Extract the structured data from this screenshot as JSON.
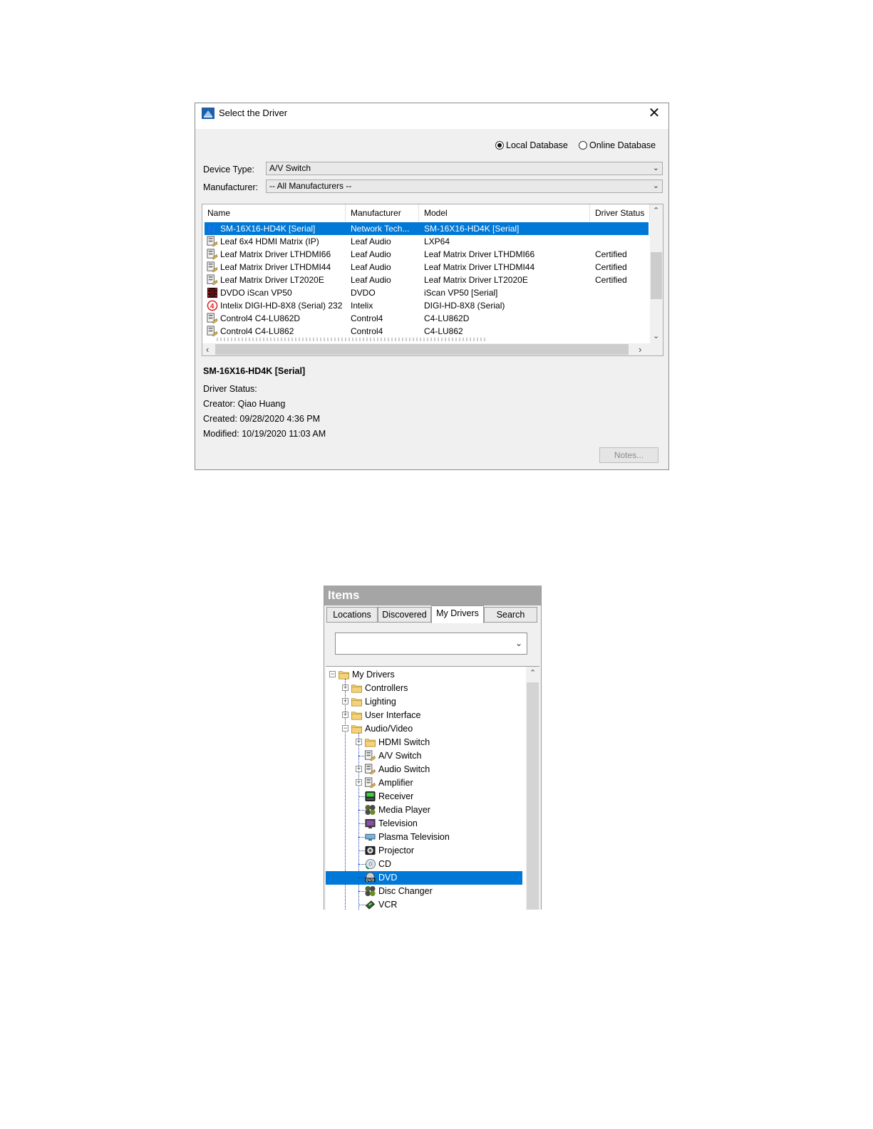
{
  "dialog": {
    "title": "Select the Driver",
    "close_glyph": "✕",
    "local_db_label": "Local Database",
    "online_db_label": "Online Database",
    "device_type_label": "Device Type:",
    "device_type_value": "A/V Switch",
    "manufacturer_label": "Manufacturer:",
    "manufacturer_value": "-- All Manufacturers --",
    "columns": [
      "Name",
      "Manufacturer",
      "Model",
      "Driver Status"
    ],
    "rows": [
      {
        "name": "SM-16X16-HD4K [Serial]",
        "manufacturer": "Network Tech...",
        "model": "SM-16X16-HD4K [Serial]",
        "status": "",
        "icon": "network-tech-icon",
        "selected": true
      },
      {
        "name": "Leaf 6x4 HDMI Matrix (IP)",
        "manufacturer": "Leaf Audio",
        "model": "LXP64",
        "status": "",
        "icon": "switch-driver-icon"
      },
      {
        "name": "Leaf Matrix Driver LTHDMI66",
        "manufacturer": "Leaf Audio",
        "model": "Leaf Matrix Driver LTHDMI66",
        "status": "Certified",
        "icon": "switch-driver-icon"
      },
      {
        "name": "Leaf Matrix Driver LTHDMI44",
        "manufacturer": "Leaf Audio",
        "model": "Leaf Matrix Driver LTHDMI44",
        "status": "Certified",
        "icon": "switch-driver-icon"
      },
      {
        "name": "Leaf Matrix Driver LT2020E",
        "manufacturer": "Leaf Audio",
        "model": "Leaf Matrix Driver LT2020E",
        "status": "Certified",
        "icon": "switch-driver-icon"
      },
      {
        "name": "DVDO iScan VP50",
        "manufacturer": "DVDO",
        "model": "iScan VP50 [Serial]",
        "status": "",
        "icon": "film-icon"
      },
      {
        "name": "Intelix DIGI-HD-8X8 (Serial) 232",
        "manufacturer": "Intelix",
        "model": "DIGI-HD-8X8 (Serial)",
        "status": "",
        "icon": "intelix-logo-icon"
      },
      {
        "name": "Control4 C4-LU862D",
        "manufacturer": "Control4",
        "model": "C4-LU862D",
        "status": "",
        "icon": "switch-driver-icon"
      },
      {
        "name": "Control4 C4-LU862",
        "manufacturer": "Control4",
        "model": "C4-LU862",
        "status": "",
        "icon": "switch-driver-icon"
      }
    ],
    "details": {
      "name": "SM-16X16-HD4K [Serial]",
      "status": "Driver Status:",
      "creator": "Creator: Qiao Huang",
      "created": "Created: 09/28/2020 4:36 PM",
      "modified": "Modified: 10/19/2020 11:03 AM"
    },
    "notes_label": "Notes..."
  },
  "items_panel": {
    "title": "Items",
    "tabs": [
      "Locations",
      "Discovered",
      "My Drivers",
      "Search"
    ],
    "active_tab": "My Drivers",
    "combo_value": "",
    "tree": [
      {
        "label": "My Drivers",
        "level": 0,
        "expander": "minus",
        "icon": "folder-icon"
      },
      {
        "label": "Controllers",
        "level": 1,
        "expander": "plus",
        "icon": "folder-icon"
      },
      {
        "label": "Lighting",
        "level": 1,
        "expander": "plus",
        "icon": "folder-icon"
      },
      {
        "label": "User Interface",
        "level": 1,
        "expander": "plus",
        "icon": "folder-icon"
      },
      {
        "label": "Audio/Video",
        "level": 1,
        "expander": "minus",
        "icon": "folder-icon"
      },
      {
        "label": "HDMI Switch",
        "level": 2,
        "expander": "plus",
        "icon": "folder-icon"
      },
      {
        "label": "A/V Switch",
        "level": 2,
        "expander": "",
        "icon": "switch-driver-icon"
      },
      {
        "label": "Audio Switch",
        "level": 2,
        "expander": "plus",
        "icon": "switch-driver-icon"
      },
      {
        "label": "Amplifier",
        "level": 2,
        "expander": "plus",
        "icon": "switch-driver-icon"
      },
      {
        "label": "Receiver",
        "level": 2,
        "expander": "",
        "icon": "receiver-icon"
      },
      {
        "label": "Media Player",
        "level": 2,
        "expander": "",
        "icon": "media-player-icon"
      },
      {
        "label": "Television",
        "level": 2,
        "expander": "",
        "icon": "television-icon"
      },
      {
        "label": "Plasma Television",
        "level": 2,
        "expander": "",
        "icon": "plasma-tv-icon"
      },
      {
        "label": "Projector",
        "level": 2,
        "expander": "",
        "icon": "projector-icon"
      },
      {
        "label": "CD",
        "level": 2,
        "expander": "",
        "icon": "cd-icon"
      },
      {
        "label": "DVD",
        "level": 2,
        "expander": "",
        "icon": "dvd-icon",
        "selected": true
      },
      {
        "label": "Disc Changer",
        "level": 2,
        "expander": "",
        "icon": "disc-changer-icon"
      },
      {
        "label": "VCR",
        "level": 2,
        "expander": "",
        "icon": "vcr-icon"
      }
    ]
  }
}
